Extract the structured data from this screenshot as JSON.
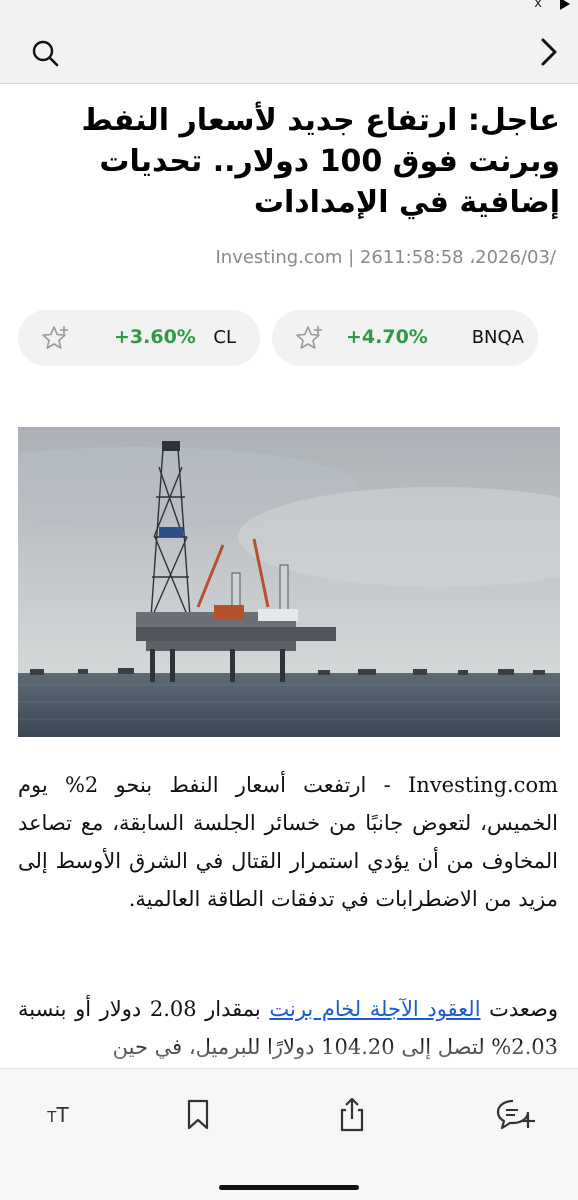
{
  "status": {
    "close_label": "x"
  },
  "topbar": {
    "search_icon": "search-icon",
    "back_icon": "chevron-right-icon"
  },
  "article": {
    "headline": "عاجل: ارتفاع جديد لأسعار النفط وبرنت فوق 100 دولار.. تحديات إضافية في الإمدادات",
    "meta": "Investing.com | 2611:58:58 ،2026/03/",
    "tickers": [
      {
        "symbol": "CL",
        "change": "+3.60%",
        "change_color": "#2e9a47",
        "icon": "star-add-icon"
      },
      {
        "symbol": "BNQA",
        "change": "+4.70%",
        "change_color": "#2e9a47",
        "icon": "star-add-icon"
      }
    ],
    "image_alt": "oil-rig-photo",
    "p1": "Investing.com - ارتفعت أسعار النفط بنحو 2% يوم الخميس، لتعوض جانبًا من خسائر الجلسة السابقة، مع تصاعد المخاوف من أن يؤدي استمرار القتال في الشرق الأوسط إلى مزيد من الاضطرابات في تدفقات الطاقة العالمية.",
    "p2_before": "وصعدت ",
    "p2_link": "العقود الآجلة لخام برنت",
    "p2_after": " بمقدار 2.08 دولار أو بنسبة 2.03% لتصل إلى 104.20 دولارًا للبرميل، في حين"
  },
  "toolbar": {
    "text_size_label_small": "T",
    "text_size_label_big": "T",
    "items": [
      "text-size-icon",
      "bookmark-icon",
      "share-icon",
      "comment-add-icon"
    ]
  },
  "colors": {
    "positive": "#2e9a47",
    "link": "#1a5bd6",
    "meta": "#8a8a8a"
  }
}
